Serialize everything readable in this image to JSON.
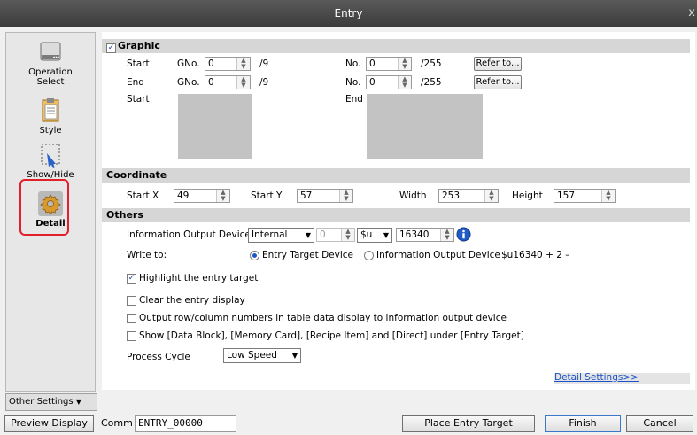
{
  "window": {
    "title": "Entry",
    "close": "x"
  },
  "sidebar": {
    "items": [
      {
        "label": "Operation\nSelect",
        "icon": "operation-select-icon"
      },
      {
        "label": "Style",
        "icon": "style-icon"
      },
      {
        "label": "Show/Hide",
        "icon": "show-hide-icon"
      },
      {
        "label": "Detail",
        "icon": "gear-icon",
        "selected": true
      }
    ],
    "other_settings": "Other Settings"
  },
  "graphic": {
    "header": "Graphic",
    "checked": true,
    "start_label": "Start",
    "end_label": "End",
    "preview_start_label": "Start",
    "preview_end_label": "End",
    "gno_label": "GNo.",
    "no_label": "No.",
    "start_gno": "0",
    "start_gno_max": "/9",
    "start_no": "0",
    "start_no_max": "/255",
    "end_gno": "0",
    "end_gno_max": "/9",
    "end_no": "0",
    "end_no_max": "/255",
    "refer_to": "Refer to..."
  },
  "coordinate": {
    "header": "Coordinate",
    "start_x_label": "Start X",
    "start_x": "49",
    "start_y_label": "Start Y",
    "start_y": "57",
    "width_label": "Width",
    "width": "253",
    "height_label": "Height",
    "height": "157"
  },
  "others": {
    "header": "Others",
    "info_output_device_label": "Information Output Device",
    "device_type": "Internal",
    "device_no": "0",
    "device_prefix": "$u",
    "device_addr": "16340",
    "write_to_label": "Write to:",
    "radio_entry_target": "Entry Target Device",
    "radio_info_output": "Information Output Device",
    "address_text": "$u16340 + 2 –",
    "highlight_label": "Highlight the entry target",
    "highlight_checked": true,
    "clear_label": "Clear the entry display",
    "output_label": "Output row/column numbers in table data display to information output device",
    "show_label": "Show [Data Block], [Memory Card], [Recipe Item] and [Direct] under [Entry Target]",
    "process_cycle_label": "Process Cycle",
    "process_cycle": "Low Speed",
    "detail_settings": "Detail Settings>>"
  },
  "bottom": {
    "preview_display": "Preview Display",
    "comm_label": "Comm",
    "comm_value": "ENTRY_00000",
    "place_entry_target": "Place Entry Target",
    "finish": "Finish",
    "cancel": "Cancel"
  }
}
